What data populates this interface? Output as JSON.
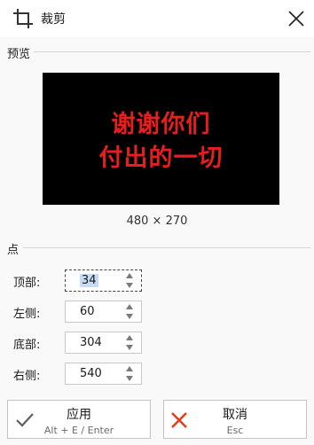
{
  "window": {
    "title": "裁剪"
  },
  "preview": {
    "heading": "预览",
    "image_lines": [
      "谢谢你们",
      "付出的一切"
    ],
    "dimensions": "480 × 270"
  },
  "points": {
    "heading": "点",
    "fields": [
      {
        "label": "顶部:",
        "value": "34"
      },
      {
        "label": "左侧:",
        "value": "60"
      },
      {
        "label": "底部:",
        "value": "304"
      },
      {
        "label": "右侧:",
        "value": "540"
      }
    ]
  },
  "buttons": {
    "apply": {
      "label": "应用",
      "shortcut": "Alt + E / Enter"
    },
    "cancel": {
      "label": "取消",
      "shortcut": "Esc"
    }
  },
  "colors": {
    "preview_text": "#e81e1e",
    "apply_check": "#5f5f5f",
    "cancel_x": "#e0401a"
  }
}
